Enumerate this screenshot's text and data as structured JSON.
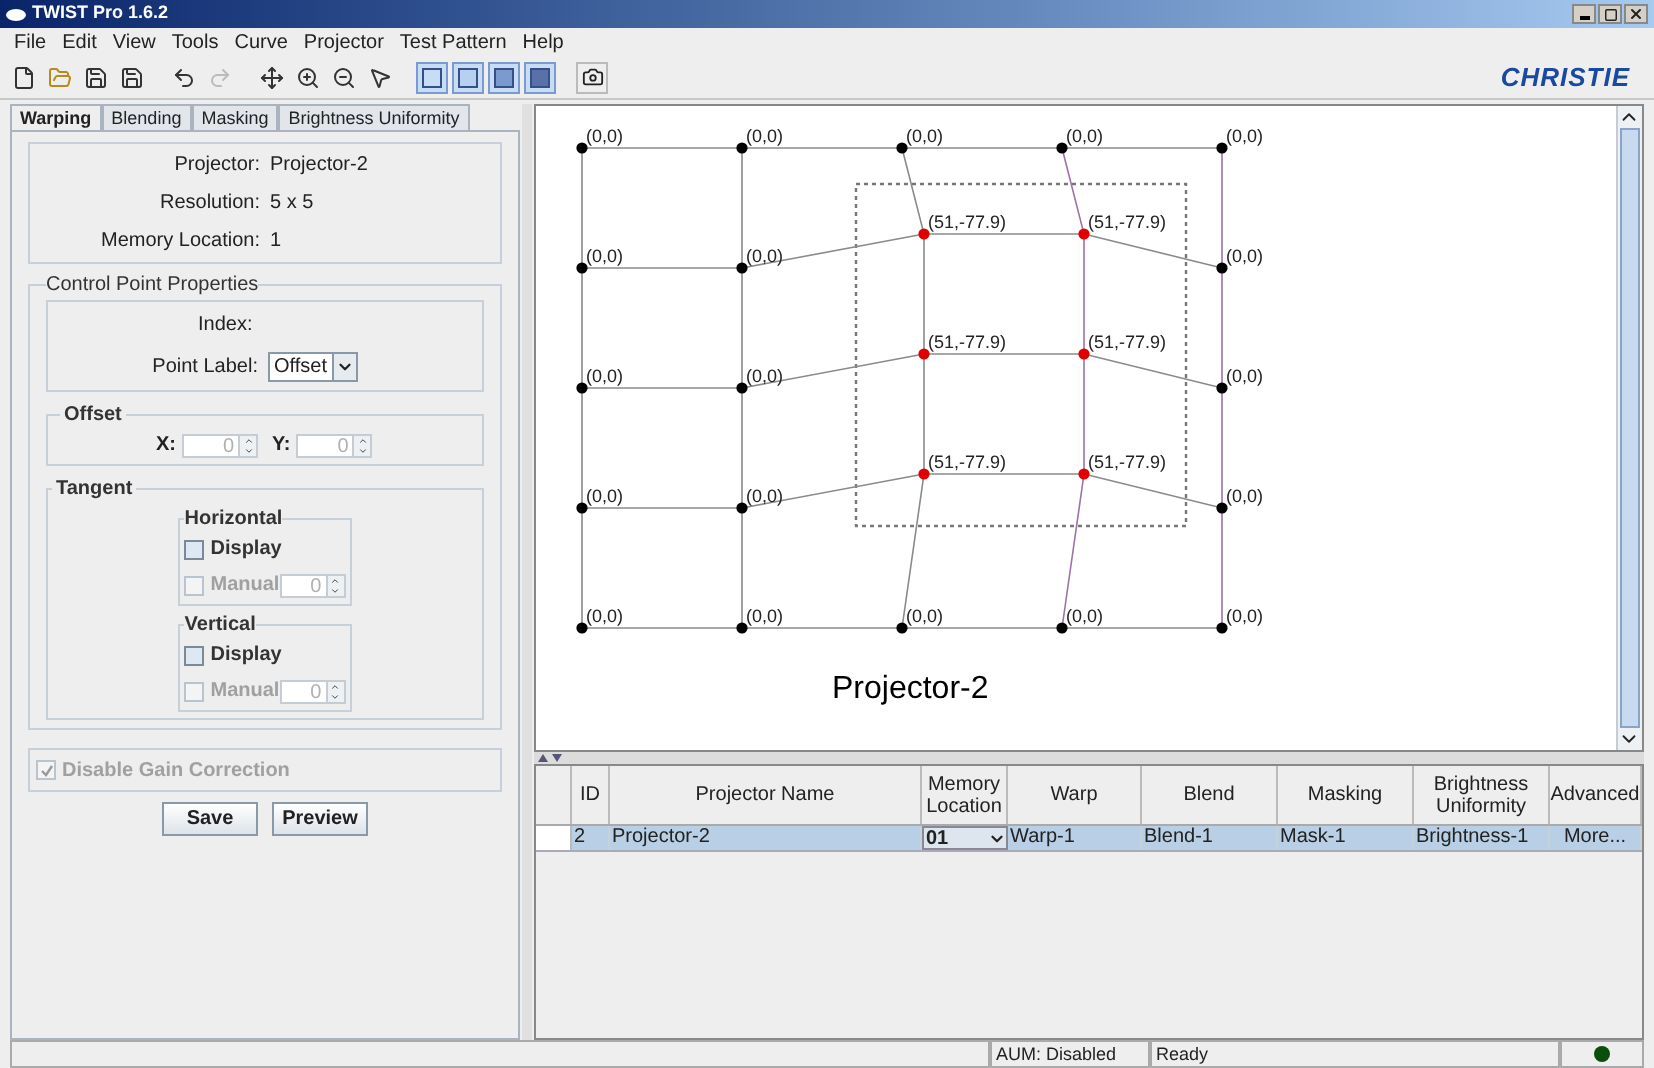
{
  "window": {
    "title": "TWIST Pro 1.6.2"
  },
  "menu": [
    "File",
    "Edit",
    "View",
    "Tools",
    "Curve",
    "Projector",
    "Test Pattern",
    "Help"
  ],
  "brand": "CHRISTIE",
  "tabs": [
    {
      "label": "Warping",
      "selected": true
    },
    {
      "label": "Blending",
      "selected": false
    },
    {
      "label": "Masking",
      "selected": false
    },
    {
      "label": "Brightness Uniformity",
      "selected": false
    }
  ],
  "info": [
    {
      "label": "Projector:",
      "value": "Projector-2"
    },
    {
      "label": "Resolution:",
      "value": "5 x 5"
    },
    {
      "label": "Memory Location:",
      "value": "1"
    }
  ],
  "control_point": {
    "title": "Control Point Properties",
    "index_label": "Index:",
    "point_label": {
      "label": "Point Label:",
      "value": "Offset"
    },
    "offset": {
      "title": "Offset",
      "x": {
        "label": "X:",
        "value": "0"
      },
      "y": {
        "label": "Y:",
        "value": "0"
      }
    },
    "tangent": {
      "title": "Tangent",
      "groups": [
        {
          "title": "Horizontal",
          "display": {
            "label": "Display",
            "checked": false
          },
          "manual": {
            "label": "Manual",
            "checked": false,
            "disabled": true,
            "value": "0"
          }
        },
        {
          "title": "Vertical",
          "display": {
            "label": "Display",
            "checked": false
          },
          "manual": {
            "label": "Manual",
            "checked": false,
            "disabled": true,
            "value": "0"
          }
        }
      ]
    }
  },
  "gain": {
    "label": "Disable Gain Correction",
    "checked": true,
    "disabled": true
  },
  "buttons": [
    "Save",
    "Preview"
  ],
  "canvas": {
    "rows": [
      {
        "points": [
          {
            "label": "(0,0)",
            "color": "#000000"
          },
          {
            "label": "(0,0)",
            "color": "#000000"
          },
          {
            "label": "(0,0)",
            "color": "#000000"
          },
          {
            "label": "(0,0)",
            "color": "#000000"
          },
          {
            "label": "(0,0)",
            "color": "#000000"
          }
        ]
      },
      {
        "points": [
          {
            "label": "(0,0)",
            "color": "#000000"
          },
          {
            "label": "(0,0)",
            "color": "#000000"
          },
          {
            "label": "(51,-77.9)",
            "color": "#e00000"
          },
          {
            "label": "(51,-77.9)",
            "color": "#e00000"
          },
          {
            "label": "(0,0)",
            "color": "#000000"
          }
        ]
      },
      {
        "points": [
          {
            "label": "(0,0)",
            "color": "#000000"
          },
          {
            "label": "(0,0)",
            "color": "#000000"
          },
          {
            "label": "(51,-77.9)",
            "color": "#e00000"
          },
          {
            "label": "(51,-77.9)",
            "color": "#e00000"
          },
          {
            "label": "(0,0)",
            "color": "#000000"
          }
        ]
      },
      {
        "points": [
          {
            "label": "(0,0)",
            "color": "#000000"
          },
          {
            "label": "(0,0)",
            "color": "#000000"
          },
          {
            "label": "(51,-77.9)",
            "color": "#e00000"
          },
          {
            "label": "(51,-77.9)",
            "color": "#e00000"
          },
          {
            "label": "(0,0)",
            "color": "#000000"
          }
        ]
      },
      {
        "points": [
          {
            "label": "(0,0)",
            "color": "#000000"
          },
          {
            "label": "(0,0)",
            "color": "#000000"
          },
          {
            "label": "(0,0)",
            "color": "#000000"
          },
          {
            "label": "(0,0)",
            "color": "#000000"
          },
          {
            "label": "(0,0)",
            "color": "#000000"
          }
        ]
      }
    ],
    "caption": "Projector-2"
  },
  "table": {
    "columns": [
      "ID",
      "Projector Name",
      "Memory Location",
      "Warp",
      "Blend",
      "Masking",
      "Brightness Uniformity",
      "Advanced"
    ],
    "rows": [
      {
        "selected": true,
        "cells": [
          "2",
          "Projector-2",
          "01",
          "Warp-1",
          "Blend-1",
          "Mask-1",
          "Brightness-1",
          "More..."
        ]
      }
    ]
  },
  "status_bar": {
    "aum": "AUM: Disabled",
    "status": "Ready",
    "indicator_on": true
  }
}
